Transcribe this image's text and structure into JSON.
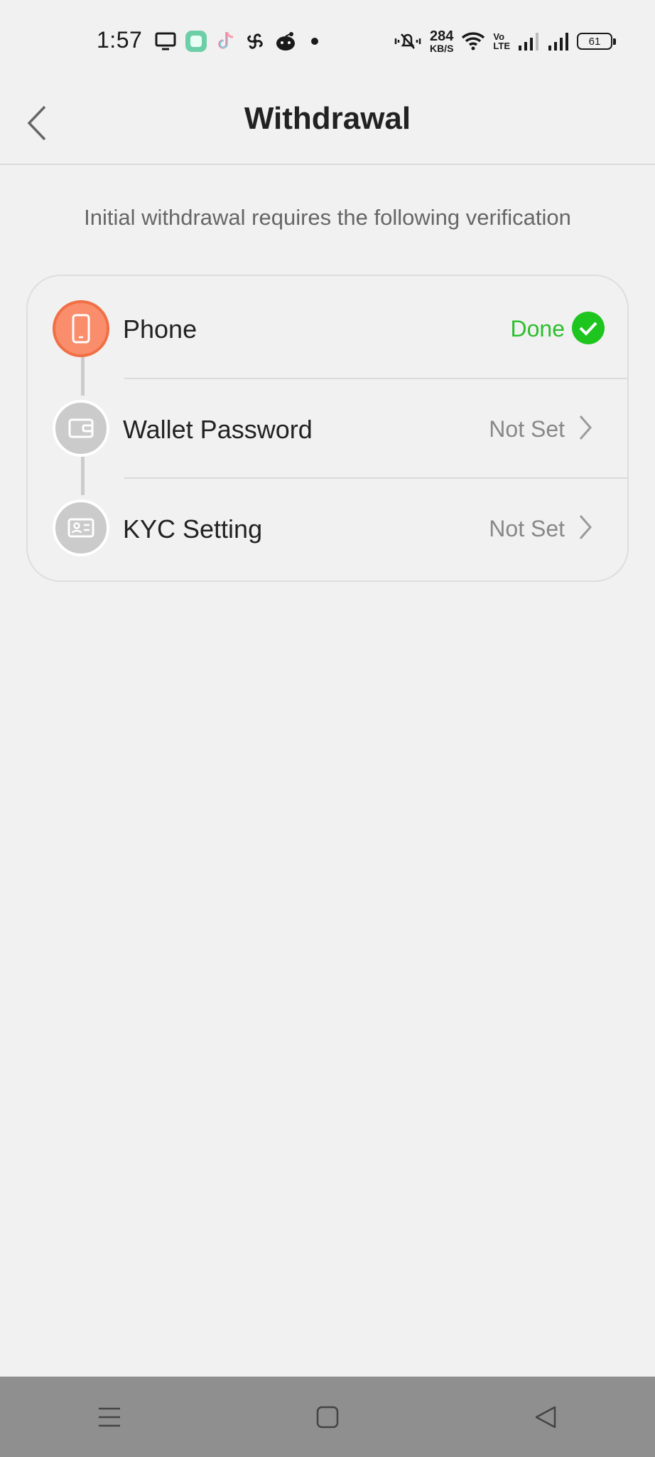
{
  "status_bar": {
    "time": "1:57",
    "net_speed_value": "284",
    "net_speed_unit": "KB/S",
    "volte_top": "Vo",
    "volte_bottom": "LTE",
    "battery": "61"
  },
  "header": {
    "title": "Withdrawal"
  },
  "subtitle": "Initial withdrawal requires the following verification",
  "steps": [
    {
      "label": "Phone",
      "status": "Done",
      "state": "done",
      "icon": "phone-icon"
    },
    {
      "label": "Wallet Password",
      "status": "Not Set",
      "state": "pending",
      "icon": "wallet-icon"
    },
    {
      "label": "KYC Setting",
      "status": "Not Set",
      "state": "pending",
      "icon": "id-card-icon"
    }
  ],
  "colors": {
    "accent_orange": "#f98d6c",
    "done_green": "#1ec51e",
    "background": "#f1f1f1",
    "nav_bar": "#8f8f8f"
  },
  "nav_bar": {
    "icons": [
      "menu-icon",
      "home-square-icon",
      "back-triangle-icon"
    ]
  }
}
